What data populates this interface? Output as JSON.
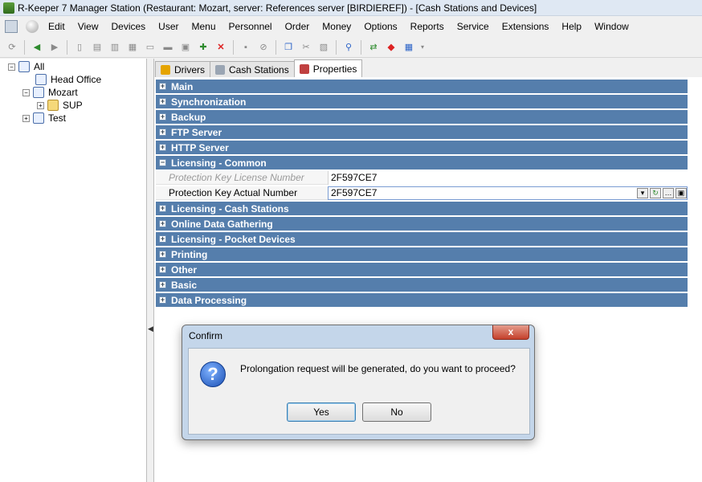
{
  "window": {
    "title": "R-Keeper 7 Manager Station (Restaurant: Mozart, server: References server [BIRDIEREF]) - [Cash Stations and Devices]"
  },
  "menu": [
    "Edit",
    "View",
    "Devices",
    "User",
    "Menu",
    "Personnel",
    "Order",
    "Money",
    "Options",
    "Reports",
    "Service",
    "Extensions",
    "Help",
    "Window"
  ],
  "tree": {
    "root": "All",
    "items": [
      "Head Office",
      "Mozart",
      "SUP",
      "Test"
    ]
  },
  "tabs": [
    "Drivers",
    "Cash Stations",
    "Properties"
  ],
  "properties": {
    "groups_before": [
      "Main",
      "Synchronization",
      "Backup",
      "FTP Server",
      "HTTP Server"
    ],
    "expanded_group": "Licensing - Common",
    "rows": [
      {
        "name": "Protection Key License Number",
        "value": "2F597CE7"
      },
      {
        "name": "Protection Key Actual Number",
        "value": "2F597CE7"
      }
    ],
    "groups_after": [
      "Licensing - Cash Stations",
      "Online Data Gathering",
      "Licensing - Pocket Devices",
      "Printing",
      "Other",
      "Basic",
      "Data Processing"
    ]
  },
  "dialog": {
    "title": "Confirm",
    "message": "Prolongation request will be generated, do you want to proceed?",
    "yes_label": "Yes",
    "no_label": "No",
    "close_glyph": "x"
  }
}
